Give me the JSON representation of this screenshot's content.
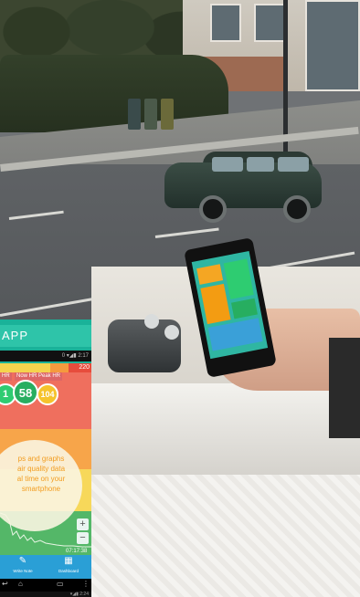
{
  "inset_app": {
    "title": "APP",
    "status_time": "0 ▾◢▮ 2:17",
    "scale_max": "220",
    "hr_labels": {
      "min": "HR",
      "now": "Now HR",
      "peak": "Peak HR"
    },
    "hr_values": {
      "min": "1",
      "now": "58",
      "peak": "104"
    },
    "caption_lines": [
      "ps and graphs",
      "air quality data",
      "al time on your",
      "smartphone"
    ],
    "zoom_in": "+",
    "zoom_out": "−",
    "chart_time": "07:17:38",
    "nav": [
      {
        "icon": "pencil-icon",
        "glyph": "✎",
        "label": "Write Note"
      },
      {
        "icon": "dashboard-icon",
        "glyph": "▦",
        "label": "Dashboard"
      }
    ],
    "sys_nav": {
      "back": "↩",
      "home": "⌂",
      "recent": "▭",
      "menu": "⋮"
    },
    "status_bottom": "▾◢▮ 2:24"
  },
  "colors": {
    "app_teal": "#1ab299",
    "red_band": "#ef6f5e",
    "orange_band": "#f7a54a",
    "yellow_band": "#f7d85a",
    "green_band": "#54b768",
    "nav_blue": "#2a9fd6"
  }
}
